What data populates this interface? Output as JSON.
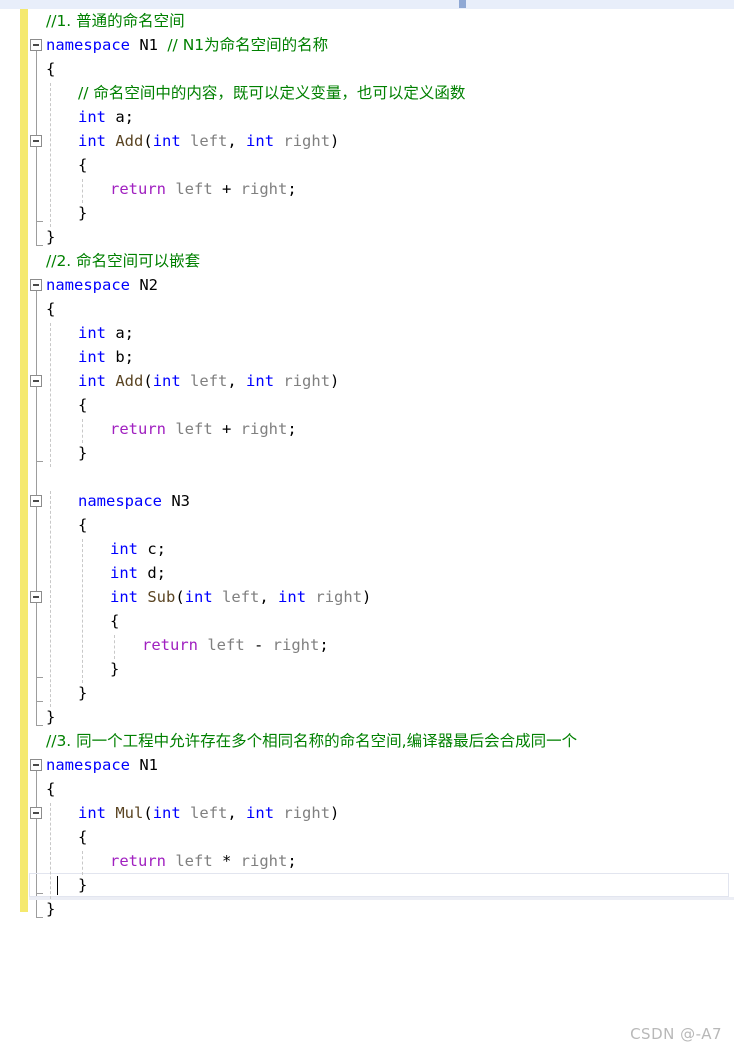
{
  "app": {
    "kind": "code-editor",
    "language": "C++",
    "theme": "light"
  },
  "scrollbar": {
    "orientation": "horizontal",
    "position": "top"
  },
  "watermark": {
    "text": "CSDN @-A7"
  },
  "colors": {
    "keyword": "#0000ff",
    "return_keyword": "#a020c0",
    "function_name": "#5a4422",
    "parameter": "#808080",
    "comment": "#008000",
    "plain": "#000000",
    "change_bar": "#f5e96e",
    "indent_guide": "#c8c8c8",
    "fold_marker": "#9d9d9d",
    "watermark": "#b8b8b8",
    "current_line_border": "#e2e5ef",
    "scrollbar_track": "#e8eefa",
    "scrollbar_thumb": "#8fa8d4"
  },
  "editor": {
    "line_height": 24,
    "font_size": 15.5,
    "caret_line": 37,
    "lines": [
      {
        "n": 1,
        "indent": 0,
        "tokens": [
          {
            "t": "//1. 普通的命名空间",
            "c": "cmt"
          }
        ]
      },
      {
        "n": 2,
        "indent": 0,
        "fold": "start",
        "tokens": [
          {
            "t": "namespace",
            "c": "kw"
          },
          {
            "t": " N1 ",
            "c": "pl"
          },
          {
            "t": "// N1为命名空间的名称",
            "c": "cmt"
          }
        ]
      },
      {
        "n": 3,
        "indent": 0,
        "tokens": [
          {
            "t": "{",
            "c": "pl"
          }
        ]
      },
      {
        "n": 4,
        "indent": 1,
        "tokens": [
          {
            "t": "// 命名空间中的内容，既可以定义变量，也可以定义函数",
            "c": "cmt"
          }
        ]
      },
      {
        "n": 5,
        "indent": 1,
        "tokens": [
          {
            "t": "int",
            "c": "kw"
          },
          {
            "t": " a;",
            "c": "pl"
          }
        ]
      },
      {
        "n": 6,
        "indent": 1,
        "fold": "start",
        "tokens": [
          {
            "t": "int",
            "c": "kw"
          },
          {
            "t": " ",
            "c": "pl"
          },
          {
            "t": "Add",
            "c": "fn"
          },
          {
            "t": "(",
            "c": "pl"
          },
          {
            "t": "int",
            "c": "kw"
          },
          {
            "t": " ",
            "c": "pl"
          },
          {
            "t": "left",
            "c": "id"
          },
          {
            "t": ", ",
            "c": "pl"
          },
          {
            "t": "int",
            "c": "kw"
          },
          {
            "t": " ",
            "c": "pl"
          },
          {
            "t": "right",
            "c": "id"
          },
          {
            "t": ")",
            "c": "pl"
          }
        ]
      },
      {
        "n": 7,
        "indent": 1,
        "tokens": [
          {
            "t": "{",
            "c": "pl"
          }
        ]
      },
      {
        "n": 8,
        "indent": 2,
        "tokens": [
          {
            "t": "return",
            "c": "ret"
          },
          {
            "t": " ",
            "c": "pl"
          },
          {
            "t": "left",
            "c": "id"
          },
          {
            "t": " + ",
            "c": "pl"
          },
          {
            "t": "right",
            "c": "id"
          },
          {
            "t": ";",
            "c": "pl"
          }
        ]
      },
      {
        "n": 9,
        "indent": 1,
        "fold": "end",
        "tokens": [
          {
            "t": "}",
            "c": "pl"
          }
        ]
      },
      {
        "n": 10,
        "indent": 0,
        "fold": "end",
        "tokens": [
          {
            "t": "}",
            "c": "pl"
          }
        ]
      },
      {
        "n": 11,
        "indent": 0,
        "tokens": [
          {
            "t": "//2. 命名空间可以嵌套",
            "c": "cmt"
          }
        ]
      },
      {
        "n": 12,
        "indent": 0,
        "fold": "start",
        "tokens": [
          {
            "t": "namespace",
            "c": "kw"
          },
          {
            "t": " N2",
            "c": "pl"
          }
        ]
      },
      {
        "n": 13,
        "indent": 0,
        "tokens": [
          {
            "t": "{",
            "c": "pl"
          }
        ]
      },
      {
        "n": 14,
        "indent": 1,
        "tokens": [
          {
            "t": "int",
            "c": "kw"
          },
          {
            "t": " a;",
            "c": "pl"
          }
        ]
      },
      {
        "n": 15,
        "indent": 1,
        "tokens": [
          {
            "t": "int",
            "c": "kw"
          },
          {
            "t": " b;",
            "c": "pl"
          }
        ]
      },
      {
        "n": 16,
        "indent": 1,
        "fold": "start",
        "tokens": [
          {
            "t": "int",
            "c": "kw"
          },
          {
            "t": " ",
            "c": "pl"
          },
          {
            "t": "Add",
            "c": "fn"
          },
          {
            "t": "(",
            "c": "pl"
          },
          {
            "t": "int",
            "c": "kw"
          },
          {
            "t": " ",
            "c": "pl"
          },
          {
            "t": "left",
            "c": "id"
          },
          {
            "t": ", ",
            "c": "pl"
          },
          {
            "t": "int",
            "c": "kw"
          },
          {
            "t": " ",
            "c": "pl"
          },
          {
            "t": "right",
            "c": "id"
          },
          {
            "t": ")",
            "c": "pl"
          }
        ]
      },
      {
        "n": 17,
        "indent": 1,
        "tokens": [
          {
            "t": "{",
            "c": "pl"
          }
        ]
      },
      {
        "n": 18,
        "indent": 2,
        "tokens": [
          {
            "t": "return",
            "c": "ret"
          },
          {
            "t": " ",
            "c": "pl"
          },
          {
            "t": "left",
            "c": "id"
          },
          {
            "t": " + ",
            "c": "pl"
          },
          {
            "t": "right",
            "c": "id"
          },
          {
            "t": ";",
            "c": "pl"
          }
        ]
      },
      {
        "n": 19,
        "indent": 1,
        "fold": "end",
        "tokens": [
          {
            "t": "}",
            "c": "pl"
          }
        ]
      },
      {
        "n": 20,
        "indent": 0,
        "tokens": []
      },
      {
        "n": 21,
        "indent": 1,
        "fold": "start",
        "tokens": [
          {
            "t": "namespace",
            "c": "kw"
          },
          {
            "t": " N3",
            "c": "pl"
          }
        ]
      },
      {
        "n": 22,
        "indent": 1,
        "tokens": [
          {
            "t": "{",
            "c": "pl"
          }
        ]
      },
      {
        "n": 23,
        "indent": 2,
        "tokens": [
          {
            "t": "int",
            "c": "kw"
          },
          {
            "t": " c;",
            "c": "pl"
          }
        ]
      },
      {
        "n": 24,
        "indent": 2,
        "tokens": [
          {
            "t": "int",
            "c": "kw"
          },
          {
            "t": " d;",
            "c": "pl"
          }
        ]
      },
      {
        "n": 25,
        "indent": 2,
        "fold": "start",
        "tokens": [
          {
            "t": "int",
            "c": "kw"
          },
          {
            "t": " ",
            "c": "pl"
          },
          {
            "t": "Sub",
            "c": "fn"
          },
          {
            "t": "(",
            "c": "pl"
          },
          {
            "t": "int",
            "c": "kw"
          },
          {
            "t": " ",
            "c": "pl"
          },
          {
            "t": "left",
            "c": "id"
          },
          {
            "t": ", ",
            "c": "pl"
          },
          {
            "t": "int",
            "c": "kw"
          },
          {
            "t": " ",
            "c": "pl"
          },
          {
            "t": "right",
            "c": "id"
          },
          {
            "t": ")",
            "c": "pl"
          }
        ]
      },
      {
        "n": 26,
        "indent": 2,
        "tokens": [
          {
            "t": "{",
            "c": "pl"
          }
        ]
      },
      {
        "n": 27,
        "indent": 3,
        "tokens": [
          {
            "t": "return",
            "c": "ret"
          },
          {
            "t": " ",
            "c": "pl"
          },
          {
            "t": "left",
            "c": "id"
          },
          {
            "t": " - ",
            "c": "pl"
          },
          {
            "t": "right",
            "c": "id"
          },
          {
            "t": ";",
            "c": "pl"
          }
        ]
      },
      {
        "n": 28,
        "indent": 2,
        "fold": "end",
        "tokens": [
          {
            "t": "}",
            "c": "pl"
          }
        ]
      },
      {
        "n": 29,
        "indent": 1,
        "fold": "end",
        "tokens": [
          {
            "t": "}",
            "c": "pl"
          }
        ]
      },
      {
        "n": 30,
        "indent": 0,
        "fold": "end",
        "tokens": [
          {
            "t": "}",
            "c": "pl"
          }
        ]
      },
      {
        "n": 31,
        "indent": 0,
        "tokens": [
          {
            "t": "//3. 同一个工程中允许存在多个相同名称的命名空间,编译器最后会合成同一个",
            "c": "cmt"
          }
        ]
      },
      {
        "n": 32,
        "indent": 0,
        "fold": "start",
        "tokens": [
          {
            "t": "namespace",
            "c": "kw"
          },
          {
            "t": " N1",
            "c": "pl"
          }
        ]
      },
      {
        "n": 33,
        "indent": 0,
        "tokens": [
          {
            "t": "{",
            "c": "pl"
          }
        ]
      },
      {
        "n": 34,
        "indent": 1,
        "fold": "start",
        "tokens": [
          {
            "t": "int",
            "c": "kw"
          },
          {
            "t": " ",
            "c": "pl"
          },
          {
            "t": "Mul",
            "c": "fn"
          },
          {
            "t": "(",
            "c": "pl"
          },
          {
            "t": "int",
            "c": "kw"
          },
          {
            "t": " ",
            "c": "pl"
          },
          {
            "t": "left",
            "c": "id"
          },
          {
            "t": ", ",
            "c": "pl"
          },
          {
            "t": "int",
            "c": "kw"
          },
          {
            "t": " ",
            "c": "pl"
          },
          {
            "t": "right",
            "c": "id"
          },
          {
            "t": ")",
            "c": "pl"
          }
        ]
      },
      {
        "n": 35,
        "indent": 1,
        "tokens": [
          {
            "t": "{",
            "c": "pl"
          }
        ]
      },
      {
        "n": 36,
        "indent": 2,
        "tokens": [
          {
            "t": "return",
            "c": "ret"
          },
          {
            "t": " ",
            "c": "pl"
          },
          {
            "t": "left",
            "c": "id"
          },
          {
            "t": " * ",
            "c": "pl"
          },
          {
            "t": "right",
            "c": "id"
          },
          {
            "t": ";",
            "c": "pl"
          }
        ]
      },
      {
        "n": 37,
        "indent": 1,
        "fold": "end",
        "tokens": [
          {
            "t": "}",
            "c": "pl"
          }
        ]
      },
      {
        "n": 38,
        "indent": 0,
        "fold": "end",
        "tokens": [
          {
            "t": "}",
            "c": "pl"
          }
        ]
      }
    ]
  }
}
